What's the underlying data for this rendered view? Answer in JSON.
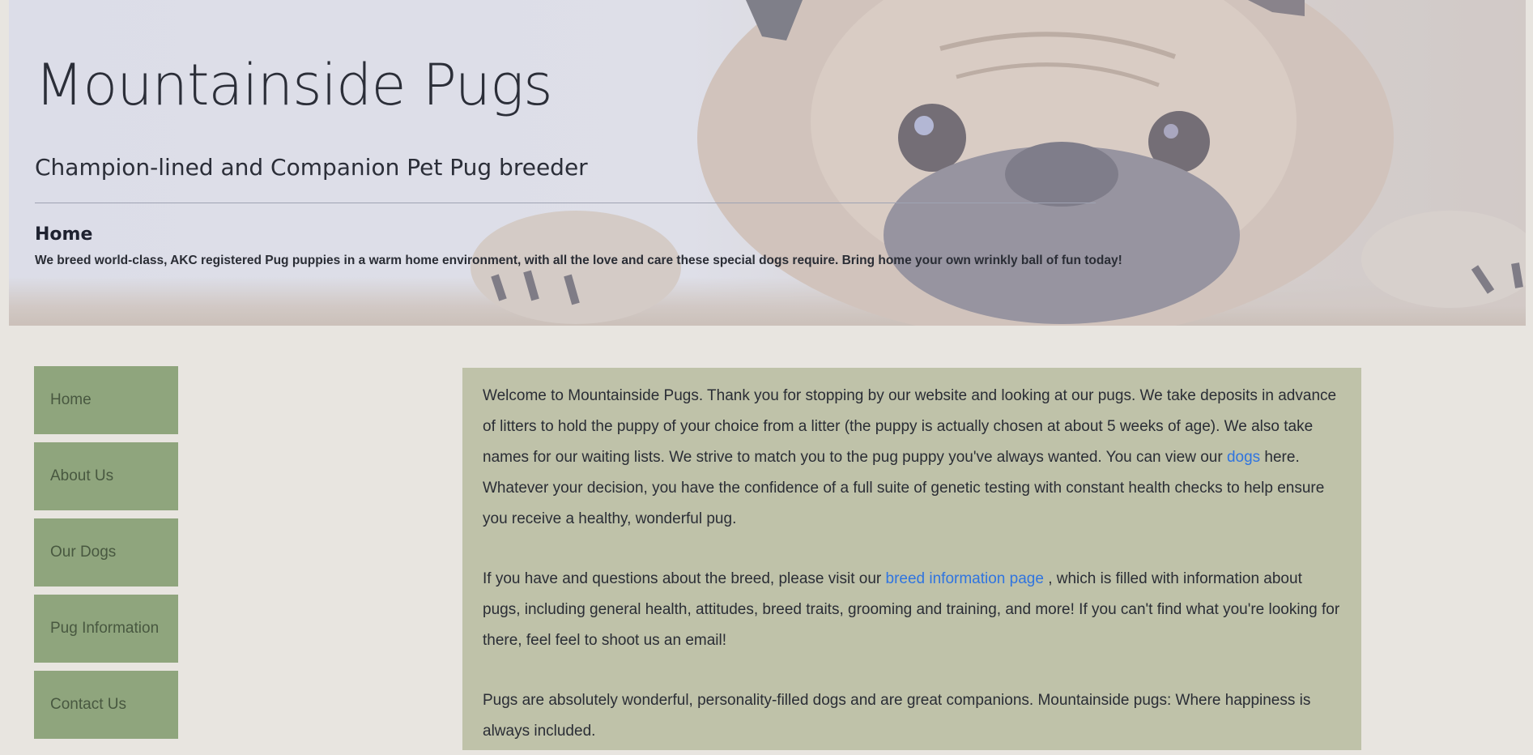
{
  "header": {
    "title": "Mountainside Pugs",
    "subtitle": "Champion-lined and Companion Pet Pug breeder",
    "page_heading": "Home",
    "intro": "We breed world-class, AKC registered Pug puppies in a warm home environment, with all the love and care these special dogs require. Bring home your own wrinkly ball of fun today!"
  },
  "nav": {
    "items": [
      {
        "label": "Home"
      },
      {
        "label": "About Us"
      },
      {
        "label": "Our Dogs"
      },
      {
        "label": "Pug Information"
      },
      {
        "label": "Contact Us"
      }
    ]
  },
  "content": {
    "p1_a": "Welcome to Mountainside Pugs. Thank you for stopping by our website and looking at our pugs. We take deposits in advance of litters to hold the puppy of your choice from a litter (the puppy is actually chosen at about 5 weeks of age). We also take names for our waiting lists. We strive to match you to the pug puppy you've always wanted. You can view our ",
    "p1_link": "dogs",
    "p1_b": " here. Whatever your decision, you have the confidence of a full suite of genetic testing with constant health checks to help ensure you receive a healthy, wonderful pug.",
    "p2_a": "If you have and questions about the breed, please visit our ",
    "p2_link": "breed information page",
    "p2_b": " , which is filled with information about pugs, including general health, attitudes, breed traits, grooming and training, and more! If you can't find what you're looking for there, feel feel to shoot us an email!",
    "p3": "Pugs are absolutely wonderful, personality-filled dogs and are great companions. Mountainside pugs: Where happiness is always included."
  },
  "colors": {
    "page_bg": "#e8e5e0",
    "nav_bg": "#8fa57d",
    "content_bg": "#bfc2a9",
    "link": "#2f74e0"
  }
}
